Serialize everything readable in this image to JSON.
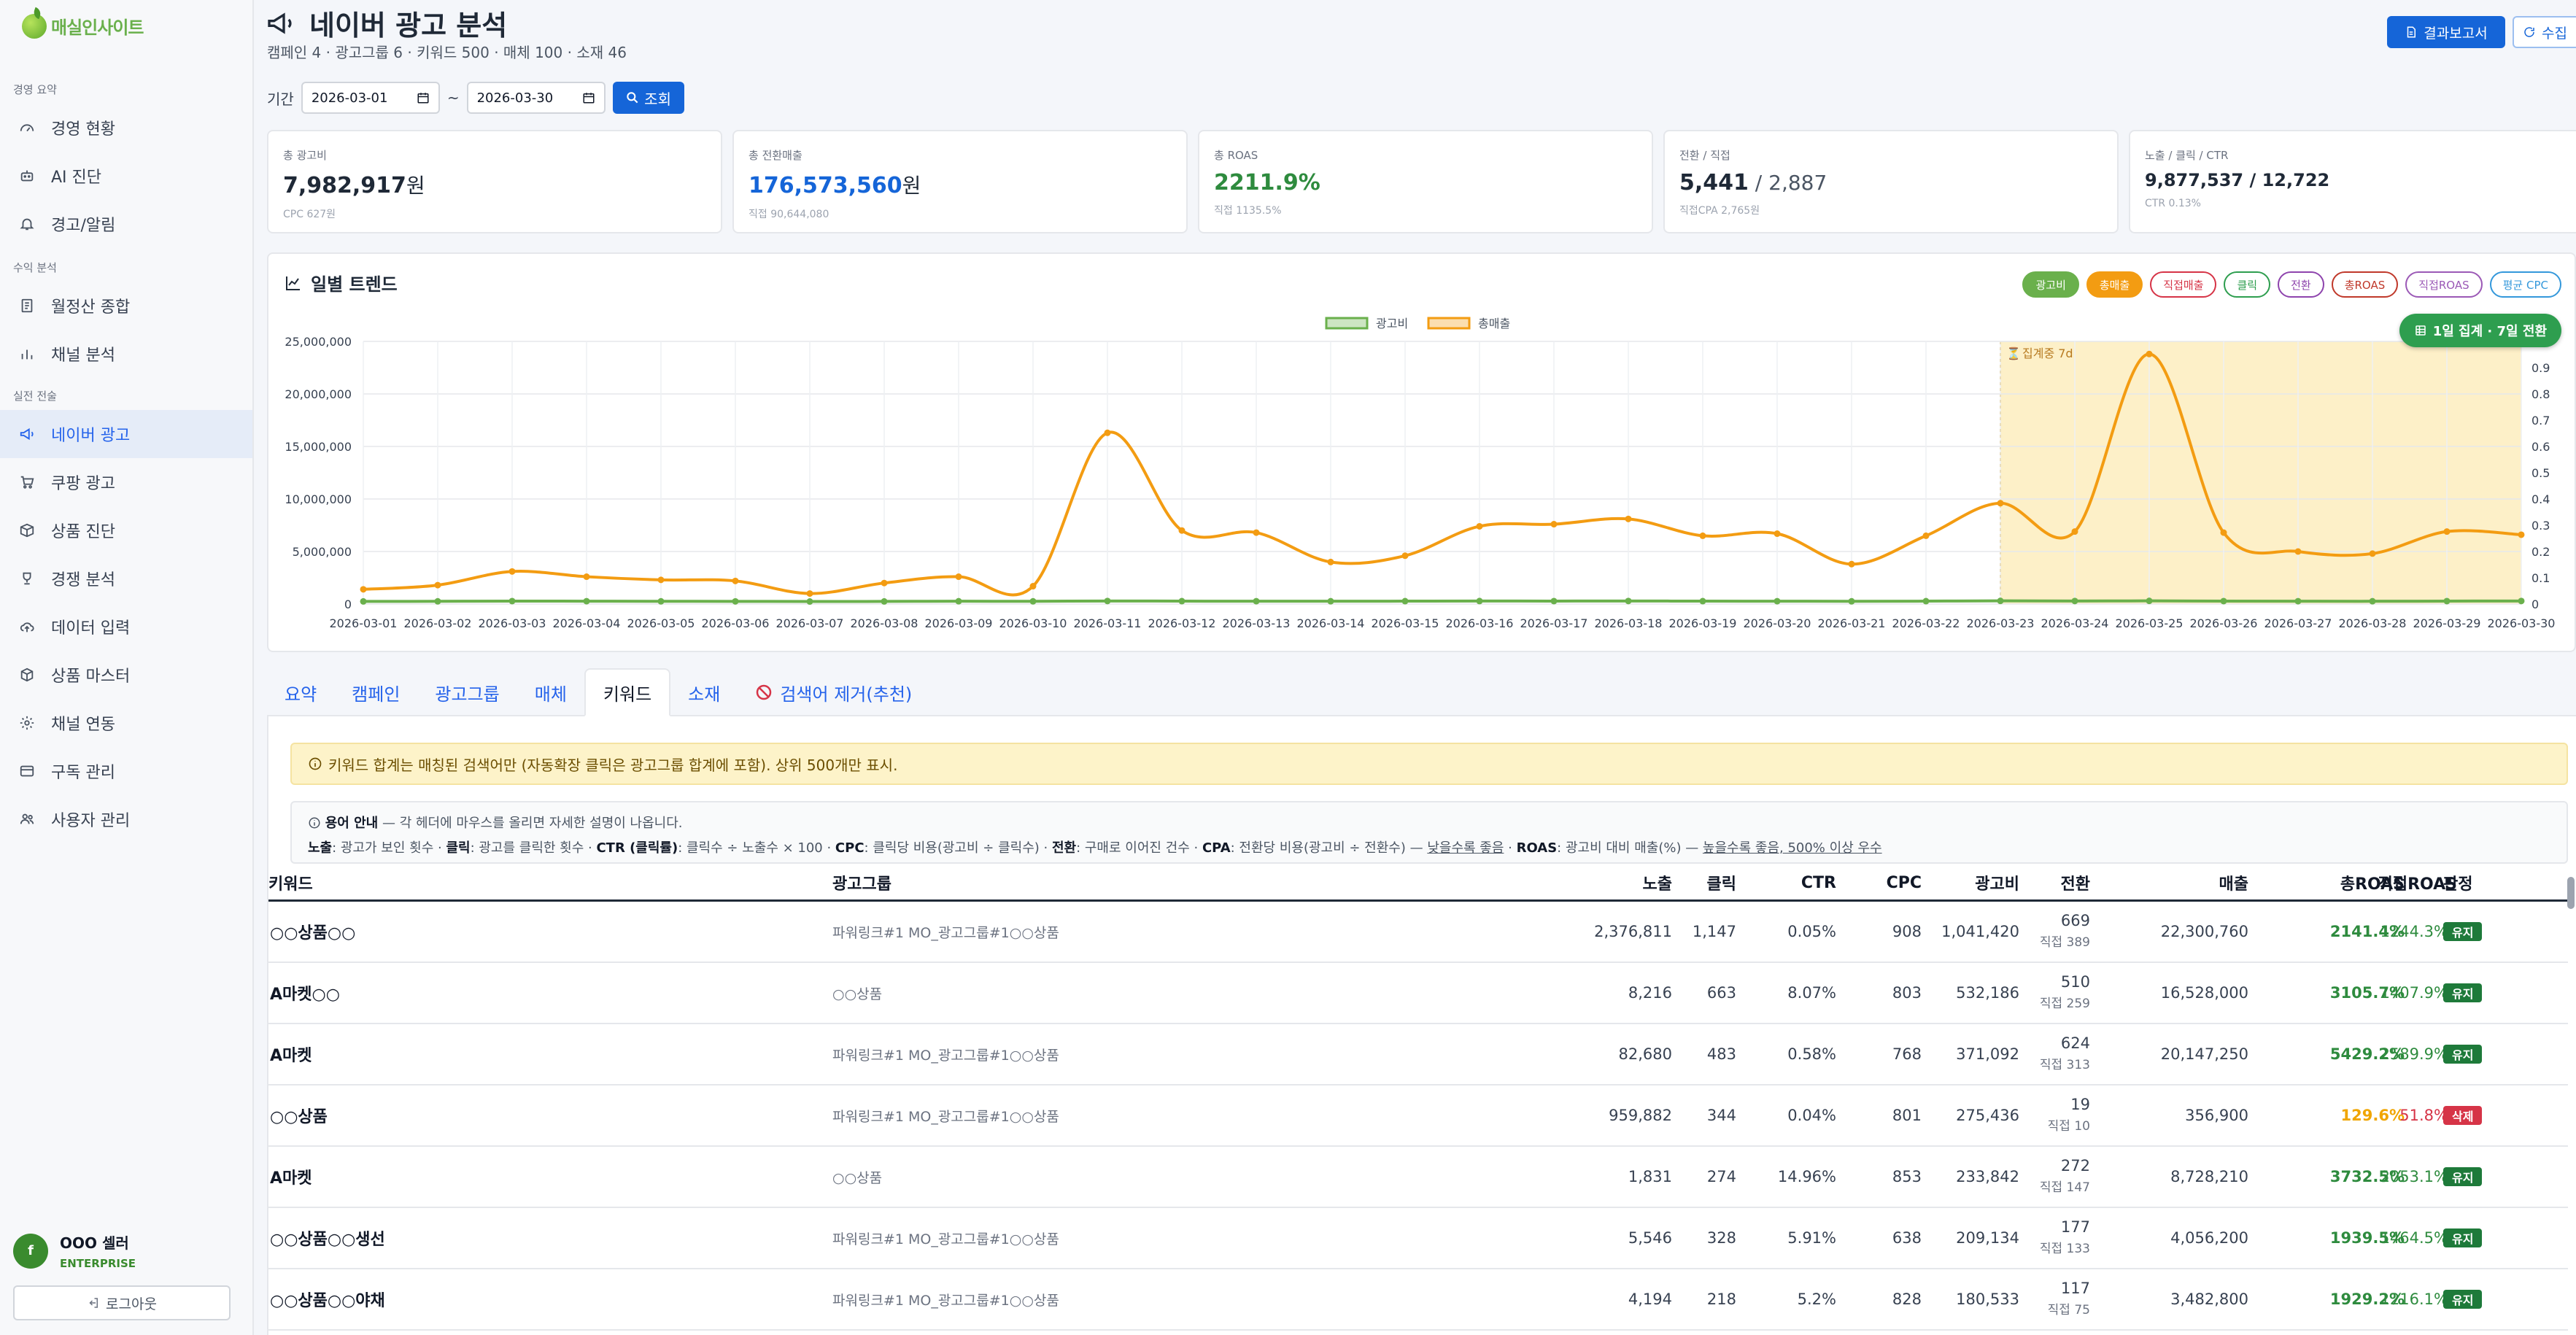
{
  "app": {
    "logo_text": "매실인사이트",
    "brand_color": "#6ab04c"
  },
  "sidebar": {
    "groups": [
      {
        "label": "경영 요약",
        "items": [
          {
            "label": "경영 현황",
            "icon": "gauge-icon"
          },
          {
            "label": "AI 진단",
            "icon": "robot-icon"
          },
          {
            "label": "경고/알림",
            "icon": "bell-icon"
          }
        ]
      },
      {
        "label": "수익 분석",
        "items": [
          {
            "label": "월정산 종합",
            "icon": "receipt-icon"
          },
          {
            "label": "채널 분석",
            "icon": "bar-chart-icon"
          }
        ]
      },
      {
        "label": "실전 전술",
        "items": [
          {
            "label": "네이버 광고",
            "icon": "megaphone-icon",
            "active": true
          },
          {
            "label": "쿠팡 광고",
            "icon": "cart-icon"
          },
          {
            "label": "상품 진단",
            "icon": "box-icon"
          },
          {
            "label": "경쟁 분석",
            "icon": "trophy-icon"
          },
          {
            "label": "데이터 입력",
            "icon": "cloud-upload-icon"
          },
          {
            "label": "상품 마스터",
            "icon": "cube-icon"
          },
          {
            "label": "채널 연동",
            "icon": "gear-icon"
          },
          {
            "label": "구독 관리",
            "icon": "card-icon"
          },
          {
            "label": "사용자 관리",
            "icon": "users-icon"
          }
        ]
      }
    ],
    "user": {
      "avatar": "f",
      "name": "OOO 셀러",
      "plan": "ENTERPRISE"
    },
    "logout_label": "로그아웃"
  },
  "header": {
    "title": "네이버 광고 분석",
    "subtitle": "캠페인 4 · 광고그룹 6 · 키워드 500 · 매체 100 · 소재 46",
    "report_button": "결과보고서",
    "collect_button": "수집"
  },
  "period": {
    "label": "기간",
    "start": "2026-03-01",
    "separator": "~",
    "end": "2026-03-30",
    "search_button": "조회"
  },
  "kpis": [
    {
      "label": "총 광고비",
      "value": "7,982,917",
      "unit": "원",
      "note": "CPC 627원",
      "color": "#1f2937"
    },
    {
      "label": "총 전환매출",
      "value": "176,573,560",
      "unit": "원",
      "note": "직접 90,644,080",
      "color": "#1565d8"
    },
    {
      "label": "총 ROAS",
      "value": "2211.9%",
      "unit": "",
      "note": "직접 1135.5%",
      "color": "#2e8b3e"
    },
    {
      "label": "전환 / 직접",
      "value": "5,441",
      "secondary": " / 2,887",
      "note": "직접CPA 2,765원",
      "color": "#1f2937"
    },
    {
      "label": "노출 / 클릭 / CTR",
      "value": "9,877,537 / 12,722",
      "unit": "",
      "note": "CTR 0.13%",
      "color": "#1f2937"
    }
  ],
  "chart": {
    "title": "일별 트렌드",
    "pills": [
      {
        "label": "광고비",
        "color": "#6ab04c",
        "filled": true
      },
      {
        "label": "총매출",
        "color": "#f39c12",
        "filled": true
      },
      {
        "label": "직접매출",
        "color": "#d63447",
        "filled": false
      },
      {
        "label": "클릭",
        "color": "#2e9e4f",
        "filled": false
      },
      {
        "label": "전환",
        "color": "#8e44ad",
        "filled": false
      },
      {
        "label": "총ROAS",
        "color": "#c0392b",
        "filled": false
      },
      {
        "label": "직접ROAS",
        "color": "#9b59b6",
        "filled": false
      },
      {
        "label": "평균 CPC",
        "color": "#3498db",
        "filled": false
      }
    ],
    "agg_button": "1일 집계 · 7일 전환",
    "aggregating_label": "집계중 7d"
  },
  "chart_data": {
    "type": "line",
    "x": [
      "2026-03-01",
      "2026-03-02",
      "2026-03-03",
      "2026-03-04",
      "2026-03-05",
      "2026-03-06",
      "2026-03-07",
      "2026-03-08",
      "2026-03-09",
      "2026-03-10",
      "2026-03-11",
      "2026-03-12",
      "2026-03-13",
      "2026-03-14",
      "2026-03-15",
      "2026-03-16",
      "2026-03-17",
      "2026-03-18",
      "2026-03-19",
      "2026-03-20",
      "2026-03-21",
      "2026-03-22",
      "2026-03-23",
      "2026-03-24",
      "2026-03-25",
      "2026-03-26",
      "2026-03-27",
      "2026-03-28",
      "2026-03-29",
      "2026-03-30"
    ],
    "series": [
      {
        "name": "광고비",
        "color": "#6ab04c",
        "values": [
          250000,
          260000,
          280000,
          270000,
          260000,
          255000,
          240000,
          250000,
          265000,
          260000,
          290000,
          275000,
          270000,
          265000,
          275000,
          285000,
          280000,
          290000,
          275000,
          270000,
          260000,
          275000,
          300000,
          290000,
          300000,
          280000,
          270000,
          265000,
          280000,
          290000
        ]
      },
      {
        "name": "총매출",
        "color": "#f39c12",
        "values": [
          1400000,
          1800000,
          3100000,
          2600000,
          2300000,
          2200000,
          1000000,
          2000000,
          2600000,
          1700000,
          16300000,
          7000000,
          6800000,
          4000000,
          4600000,
          7400000,
          7600000,
          8100000,
          6500000,
          6700000,
          3800000,
          6500000,
          9600000,
          6900000,
          23800000,
          6800000,
          5000000,
          4800000,
          6900000,
          6600000
        ]
      }
    ],
    "ylim": [
      0,
      25000000
    ],
    "yticks": [
      "0",
      "5,000,000",
      "10,000,000",
      "15,000,000",
      "20,000,000",
      "25,000,000"
    ],
    "y2ticks": [
      "0",
      "0.1",
      "0.2",
      "0.3",
      "0.4",
      "0.5",
      "0.6",
      "0.7",
      "0.8",
      "0.9",
      "1.0"
    ],
    "y2lim": [
      0,
      1
    ],
    "highlight_range": [
      "2026-03-23",
      "2026-03-30"
    ],
    "legend": "top-center",
    "grid": true
  },
  "tabs": [
    {
      "label": "요약"
    },
    {
      "label": "캠페인"
    },
    {
      "label": "광고그룹"
    },
    {
      "label": "매체"
    },
    {
      "label": "키워드",
      "active": true
    },
    {
      "label": "소재"
    },
    {
      "label": "검색어 제거(추천)",
      "icon": "prohibit-icon"
    }
  ],
  "notice": "키워드 합계는 매칭된 검색어만 (자동확장 클릭은 광고그룹 합계에 포함). 상위 500개만 표시.",
  "guide": {
    "title": "용어 안내",
    "title_rest": "— 각 헤더에 마우스를 올리면 자세한 설명이 나옵니다.",
    "items": [
      {
        "term": "노출",
        "desc": ": 광고가 보인 횟수 · "
      },
      {
        "term": "클릭",
        "desc": ": 광고를 클릭한 횟수 · "
      },
      {
        "term": "CTR (클릭률)",
        "desc": ": 클릭수 ÷ 노출수 × 100 · "
      },
      {
        "term": "CPC",
        "desc": ": 클릭당 비용(광고비 ÷ 클릭수) · "
      },
      {
        "term": "전환",
        "desc": ": 구매로 이어진 건수 · "
      },
      {
        "term": "CPA",
        "desc": ": 전환당 비용(광고비 ÷ 전환수) — "
      },
      {
        "term": "",
        "desc": "",
        "underline": "낮을수록 좋음"
      },
      {
        "term": "ROAS",
        "desc": ": 광고비 대비 매출(%) — ",
        "pre": " · "
      },
      {
        "term": "",
        "desc": "",
        "underline": "높을수록 좋음, 500% 이상 우수"
      }
    ]
  },
  "table": {
    "headers": {
      "keyword": "키워드",
      "group": "광고그룹",
      "impr": "노출",
      "clicks": "클릭",
      "ctr": "CTR",
      "cpc": "CPC",
      "cost": "광고비",
      "conv": "전환",
      "revenue": "매출",
      "roas": "총ROAS",
      "direct_roas": "직접ROAS",
      "verdict": "판정"
    },
    "rows": [
      {
        "keyword": "○○상품○○",
        "group": "파워링크#1 MO_광고그룹#1○○상품",
        "impr": "2,376,811",
        "clicks": "1,147",
        "ctr": "0.05%",
        "cpc": "908",
        "cost": "1,041,420",
        "conv": "669",
        "conv_direct": "직접 389",
        "revenue": "22,300,760",
        "roas": "2141.4%",
        "direct_roas": "1244.3%",
        "verdict": "유지",
        "roas_color": "#2e8b3e",
        "droas_color": "#2e8b3e",
        "verdict_color": "#1e7a3a"
      },
      {
        "keyword": "A마켓○○",
        "group": "○○상품",
        "impr": "8,216",
        "clicks": "663",
        "ctr": "8.07%",
        "cpc": "803",
        "cost": "532,186",
        "conv": "510",
        "conv_direct": "직접 259",
        "revenue": "16,528,000",
        "roas": "3105.7%",
        "direct_roas": "1407.9%",
        "verdict": "유지",
        "roas_color": "#2e8b3e",
        "droas_color": "#2e8b3e",
        "verdict_color": "#1e7a3a"
      },
      {
        "keyword": "A마켓",
        "group": "파워링크#1 MO_광고그룹#1○○상품",
        "impr": "82,680",
        "clicks": "483",
        "ctr": "0.58%",
        "cpc": "768",
        "cost": "371,092",
        "conv": "624",
        "conv_direct": "직접 313",
        "revenue": "20,147,250",
        "roas": "5429.2%",
        "direct_roas": "2589.9%",
        "verdict": "유지",
        "roas_color": "#2e8b3e",
        "droas_color": "#2e8b3e",
        "verdict_color": "#1e7a3a"
      },
      {
        "keyword": "○○상품",
        "group": "파워링크#1 MO_광고그룹#1○○상품",
        "impr": "959,882",
        "clicks": "344",
        "ctr": "0.04%",
        "cpc": "801",
        "cost": "275,436",
        "conv": "19",
        "conv_direct": "직접 10",
        "revenue": "356,900",
        "roas": "129.6%",
        "direct_roas": "51.8%",
        "verdict": "삭제",
        "roas_color": "#f0a500",
        "droas_color": "#d63447",
        "verdict_color": "#d63447"
      },
      {
        "keyword": "A마켓",
        "group": "○○상품",
        "impr": "1,831",
        "clicks": "274",
        "ctr": "14.96%",
        "cpc": "853",
        "cost": "233,842",
        "conv": "272",
        "conv_direct": "직접 147",
        "revenue": "8,728,210",
        "roas": "3732.5%",
        "direct_roas": "2053.1%",
        "verdict": "유지",
        "roas_color": "#2e8b3e",
        "droas_color": "#2e8b3e",
        "verdict_color": "#1e7a3a"
      },
      {
        "keyword": "○○상품○○생선",
        "group": "파워링크#1 MO_광고그룹#1○○상품",
        "impr": "5,546",
        "clicks": "328",
        "ctr": "5.91%",
        "cpc": "638",
        "cost": "209,134",
        "conv": "177",
        "conv_direct": "직접 133",
        "revenue": "4,056,200",
        "roas": "1939.5%",
        "direct_roas": "1464.5%",
        "verdict": "유지",
        "roas_color": "#2e8b3e",
        "droas_color": "#2e8b3e",
        "verdict_color": "#1e7a3a"
      },
      {
        "keyword": "○○상품○○야채",
        "group": "파워링크#1 MO_광고그룹#1○○상품",
        "impr": "4,194",
        "clicks": "218",
        "ctr": "5.2%",
        "cpc": "828",
        "cost": "180,533",
        "conv": "117",
        "conv_direct": "직접 75",
        "revenue": "3,482,800",
        "roas": "1929.2%",
        "direct_roas": "1216.1%",
        "verdict": "유지",
        "roas_color": "#2e8b3e",
        "droas_color": "#2e8b3e",
        "verdict_color": "#1e7a3a"
      }
    ]
  }
}
